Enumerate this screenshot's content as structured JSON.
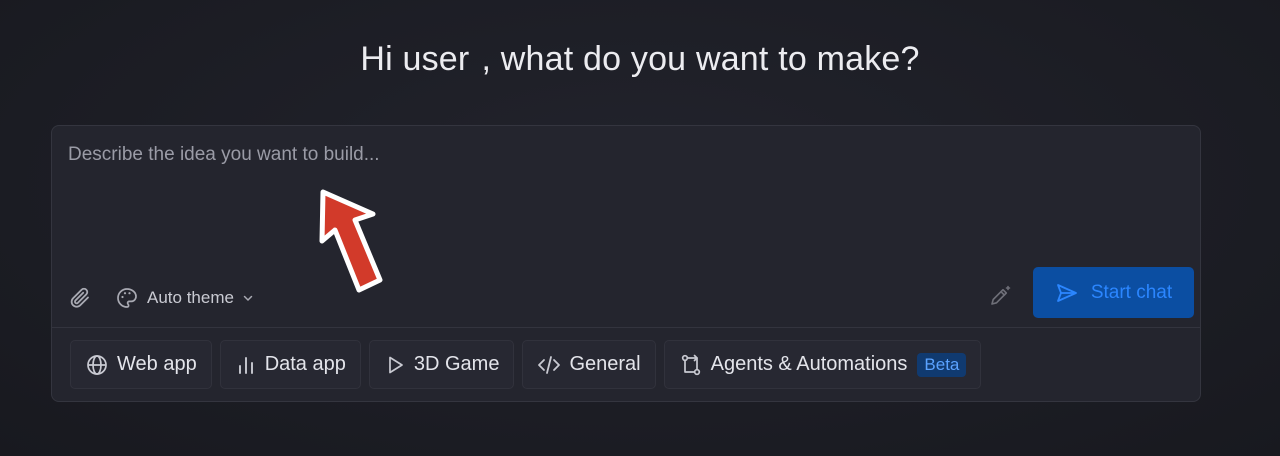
{
  "greeting": {
    "part1": "Hi user",
    "part2": ", what do you want to make?"
  },
  "composer": {
    "prompt_value": "",
    "prompt_placeholder": "Describe the idea you want to build...",
    "theme_label": "Auto theme",
    "start_label": "Start chat"
  },
  "chips": [
    {
      "label": "Web app",
      "icon": "globe-icon"
    },
    {
      "label": "Data app",
      "icon": "bar-chart-icon"
    },
    {
      "label": "3D Game",
      "icon": "play-icon"
    },
    {
      "label": "General",
      "icon": "code-icon"
    },
    {
      "label": "Agents & Automations",
      "icon": "workflow-icon",
      "badge": "Beta"
    }
  ],
  "colors": {
    "background": "#1c1d25",
    "start_button_bg": "#0b4ea2",
    "start_button_fg": "#2b86ff",
    "beta_badge_bg": "#103a70",
    "annotation_arrow": "#d23a2a"
  }
}
